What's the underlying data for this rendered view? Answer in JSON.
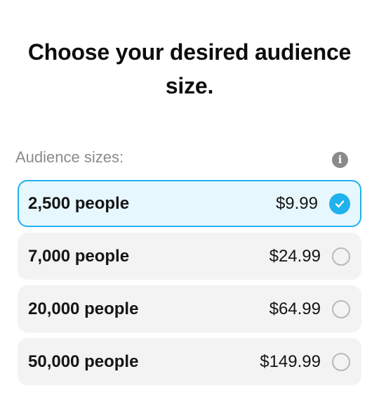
{
  "heading": "Choose your desired audience size.",
  "section_label": "Audience sizes:",
  "info_icon_glyph": "i",
  "accent_color": "#1fb2ec",
  "options": [
    {
      "label": "2,500 people",
      "price": "$9.99",
      "selected": true
    },
    {
      "label": "7,000 people",
      "price": "$24.99",
      "selected": false
    },
    {
      "label": "20,000 people",
      "price": "$64.99",
      "selected": false
    },
    {
      "label": "50,000 people",
      "price": "$149.99",
      "selected": false
    }
  ]
}
